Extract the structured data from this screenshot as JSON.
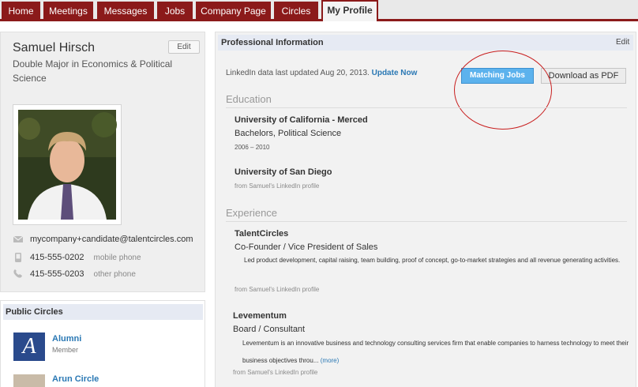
{
  "nav": {
    "tabs": [
      {
        "label": "Home"
      },
      {
        "label": "Meetings"
      },
      {
        "label": "Messages"
      },
      {
        "label": "Jobs"
      },
      {
        "label": "Company Page"
      },
      {
        "label": "Circles"
      },
      {
        "label": "My Profile",
        "active": true
      }
    ]
  },
  "profile": {
    "name": "Samuel Hirsch",
    "edit_label": "Edit",
    "headline": "Double Major in Economics & Political Science",
    "email": "mycompany+candidate@talentcircles.com",
    "phones": [
      {
        "number": "415-555-0202",
        "type": "mobile phone",
        "icon": "mobile-phone-icon"
      },
      {
        "number": "415-555-0203",
        "type": "other phone",
        "icon": "phone-icon"
      }
    ]
  },
  "public_circles": {
    "title": "Public Circles",
    "items": [
      {
        "name": "Alumni",
        "role": "Member",
        "logo_letter": "A"
      },
      {
        "name": "Arun Circle"
      }
    ]
  },
  "professional": {
    "title": "Professional Information",
    "edit_label": "Edit",
    "linkedin_updated": "LinkedIn data last updated Aug 20, 2013.",
    "update_now": "Update Now",
    "matching_jobs": "Matching Jobs",
    "download_pdf": "Download as PDF",
    "education_heading": "Education",
    "education": [
      {
        "school": "University of California - Merced",
        "degree": "Bachelors, Political Science",
        "dates": "2006 – 2010"
      },
      {
        "school": "University of San Diego",
        "source": "from Samuel's LinkedIn profile"
      }
    ],
    "experience_heading": "Experience",
    "experience": [
      {
        "company": "TalentCircles",
        "title": "Co-Founder / Vice President of Sales",
        "description": "Led product development, capital raising, team building, proof of concept, go-to-market strategies and all revenue generating activities.",
        "source": "from Samuel's LinkedIn profile"
      },
      {
        "company": "Levementum",
        "title": "Board / Consultant",
        "description": "Levementum is an innovative business and technology consulting services firm that enable companies to harness technology to meet their business objectives throu...",
        "more": "(more)",
        "source": "from Samuel's LinkedIn profile"
      }
    ]
  },
  "colors": {
    "brand": "#8b1a1a",
    "link": "#2a78b4",
    "button_blue": "#5cb2ed",
    "annotation": "#c81e1e"
  }
}
